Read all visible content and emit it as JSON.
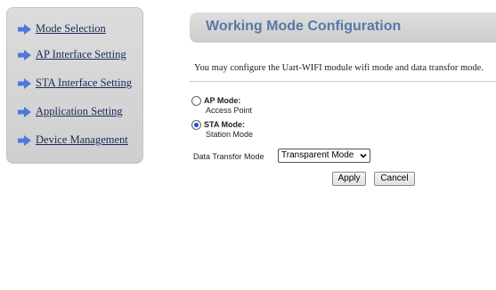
{
  "sidebar": {
    "items": [
      {
        "label": "Mode Selection",
        "icon": "arrow-right-icon"
      },
      {
        "label": "AP Interface Setting",
        "icon": "arrow-right-icon"
      },
      {
        "label": "STA Interface Setting",
        "icon": "arrow-right-icon"
      },
      {
        "label": "Application Setting",
        "icon": "arrow-right-icon"
      },
      {
        "label": "Device Management",
        "icon": "arrow-right-icon"
      }
    ]
  },
  "main": {
    "title": "Working Mode Configuration",
    "intro": "You may configure the Uart-WIFI module wifi mode and data transfor mode.",
    "modes": [
      {
        "title": "AP Mode:",
        "subtitle": "Access Point",
        "checked": false
      },
      {
        "title": "STA Mode:",
        "subtitle": "Station Mode",
        "checked": true
      }
    ],
    "data_mode_label": "Data Transfor Mode",
    "data_mode_value": "Transparent Mode",
    "apply_label": "Apply",
    "cancel_label": "Cancel"
  },
  "colors": {
    "accent": "#5878a8",
    "link": "#1a2a5c",
    "arrow": "#4a7ae0"
  }
}
